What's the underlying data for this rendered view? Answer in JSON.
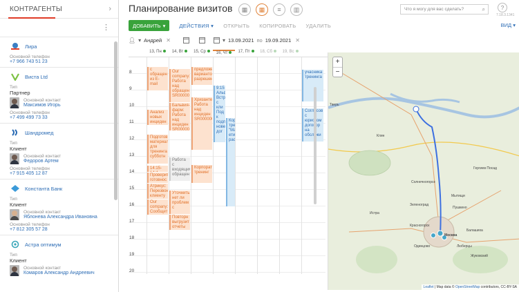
{
  "sidebar": {
    "title": "КОНТРАГЕНТЫ",
    "contacts": [
      {
        "name": "Лира",
        "phone_label": "Основной телефон",
        "phone": "+7 966 743 51 23",
        "logo_color": "#3b7fc4"
      },
      {
        "name": "Виста Ltd",
        "type_label": "Тип",
        "type": "Партнер",
        "contact_label": "Основной контакт",
        "contact": "Максимов Игорь",
        "phone_label": "Основной телефон",
        "phone": "+7 499 499 73 33",
        "logo_color": "#7cc142"
      },
      {
        "name": "Шандромед",
        "type_label": "Тип",
        "type": "Клиент",
        "contact_label": "Основной контакт",
        "contact": "Федоров Артем",
        "phone_label": "Основной телефон",
        "phone": "+7 915 405 12 87",
        "logo_color": "#2d6db5"
      },
      {
        "name": "Константа Банк",
        "type_label": "Тип",
        "type": "Клиент",
        "contact_label": "Основной контакт",
        "contact": "Яблонева Александра Ивановна",
        "phone_label": "Основной телефон",
        "phone": "+7 812 305 57 28",
        "logo_color": "#3b9ad9"
      },
      {
        "name": "Астра оптимум",
        "type_label": "Тип",
        "type": "Клиент",
        "contact_label": "Основной контакт",
        "contact": "Комаров Александр Андреевич",
        "logo_color": "#3aa6b9"
      }
    ]
  },
  "header": {
    "title": "Планирование визитов",
    "search_placeholder": "Что я могу для вас сделать?",
    "help": "?",
    "version": "7.18.3.1341"
  },
  "toolbar": {
    "add": "ДОБАВИТЬ",
    "actions": "ДЕЙСТВИЯ",
    "open": "ОТКРЫТЬ",
    "copy": "КОПИРОВАТЬ",
    "delete": "УДАЛИТЬ",
    "view": "ВИД"
  },
  "filters": {
    "owner": "Андрей",
    "date_from": "13.09.2021",
    "date_sep": "по",
    "date_to": "19.09.2021"
  },
  "days": [
    "13, Пн",
    "14, Вт",
    "15, Ср",
    "16, Чт",
    "17, Пт",
    "18, Сб",
    "19, Вс"
  ],
  "hours": [
    "8",
    "9",
    "10",
    "11",
    "12",
    "13",
    "14",
    "15",
    "16",
    "17",
    "18",
    "19",
    "20"
  ],
  "events": [
    {
      "text": "с обращен из E-mail",
      "style": "o"
    },
    {
      "text": "Анализ новых инциден",
      "style": "o"
    },
    {
      "text": "Подготов материал для тренинга субботн",
      "style": "o"
    },
    {
      "text": "14:15-14:4",
      "style": "o"
    },
    {
      "text": "Проверит готовнос",
      "style": "o"
    },
    {
      "text": "Атрикус: Перезвон клиенту",
      "style": "o"
    },
    {
      "text": "Our company: Сообщит",
      "style": "o"
    },
    {
      "text": "Our company: Работа над обращен SR00000",
      "style": "o"
    },
    {
      "text": "Бальвия-фарм: Работа над инциден SR00000",
      "style": "o"
    },
    {
      "text": "Работа с входящим обращен",
      "style": "g"
    },
    {
      "text": "Уточнить нет ли проблем с",
      "style": "o"
    },
    {
      "text": "Повторн выгрузит отчеты",
      "style": "o"
    },
    {
      "text": "предложе вариантов разрешен",
      "style": "o"
    },
    {
      "text": "Хризанте Работа над инциден SR000000",
      "style": "o"
    },
    {
      "text": "Корпоратив тренинг",
      "style": "o"
    },
    {
      "text": "9:15 Альф Встр с кли Под к подп нове дог",
      "style": "b"
    },
    {
      "text": "Кор тре \"Ма ети рас",
      "style": "b"
    },
    {
      "text": "учасника тренинга",
      "style": "b"
    },
    {
      "text": "Согласов с юристом договор на обслужи",
      "style": "b"
    }
  ],
  "map": {
    "zoom_in": "+",
    "zoom_out": "−",
    "labels": [
      "Тверь",
      "Гергиев Посад",
      "Мытищи",
      "Пушкино",
      "Красногорск",
      "Москва",
      "Одинцово",
      "Балашиха",
      "Люберцы",
      "Жуковский",
      "Истра",
      "Зеленоград",
      "Солнечногорск",
      "Клин"
    ],
    "attribution_link1": "Leaflet",
    "attribution_mid": " | Map data © ",
    "attribution_link2": "OpenStreetMap",
    "attribution_end": " contributors, CC-BY-SA"
  }
}
